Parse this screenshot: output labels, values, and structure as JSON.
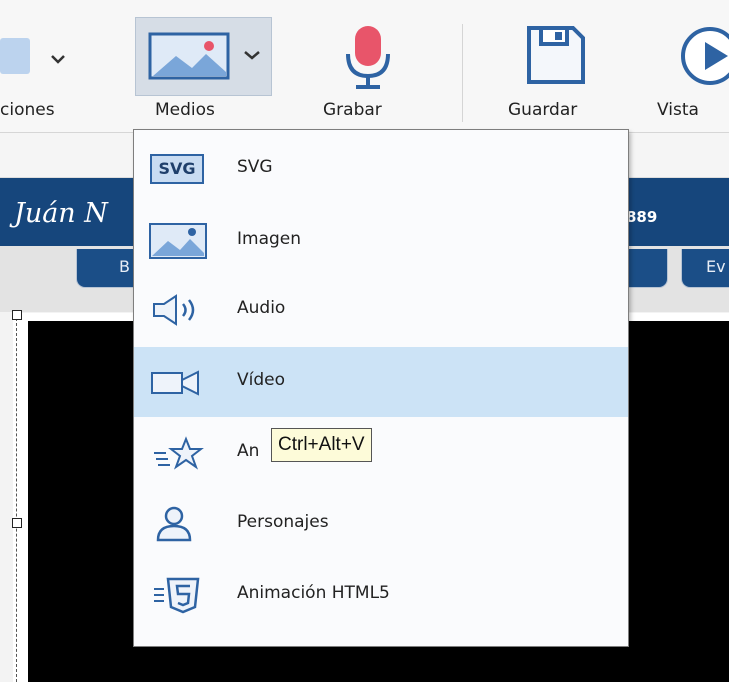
{
  "toolbar": {
    "buttons": [
      {
        "label": "ciones"
      },
      {
        "label": "Medios"
      },
      {
        "label": "Grabar"
      },
      {
        "label": "Guardar"
      },
      {
        "label": "Vista"
      }
    ]
  },
  "project": {
    "author": "Juán N",
    "number": "889",
    "tabs": [
      "B",
      "Ev"
    ]
  },
  "menu": {
    "items": [
      {
        "label": "SVG",
        "icon": "svg-icon"
      },
      {
        "label": "Imagen",
        "icon": "image-icon"
      },
      {
        "label": "Audio",
        "icon": "speaker-icon"
      },
      {
        "label": "Vídeo",
        "icon": "video-camera-icon",
        "selected": true
      },
      {
        "label": "An",
        "icon": "star-animation-icon"
      },
      {
        "label": "Personajes",
        "icon": "person-icon"
      },
      {
        "label": "Animación HTML5",
        "icon": "html5-icon"
      }
    ],
    "svg_badge": "SVG"
  },
  "tooltip": {
    "text": "Ctrl+Alt+V"
  },
  "colors": {
    "accent_blue": "#16467c",
    "selection": "#cce3f6",
    "mic_red": "#e8556a",
    "icon_blue": "#2e63a3"
  }
}
